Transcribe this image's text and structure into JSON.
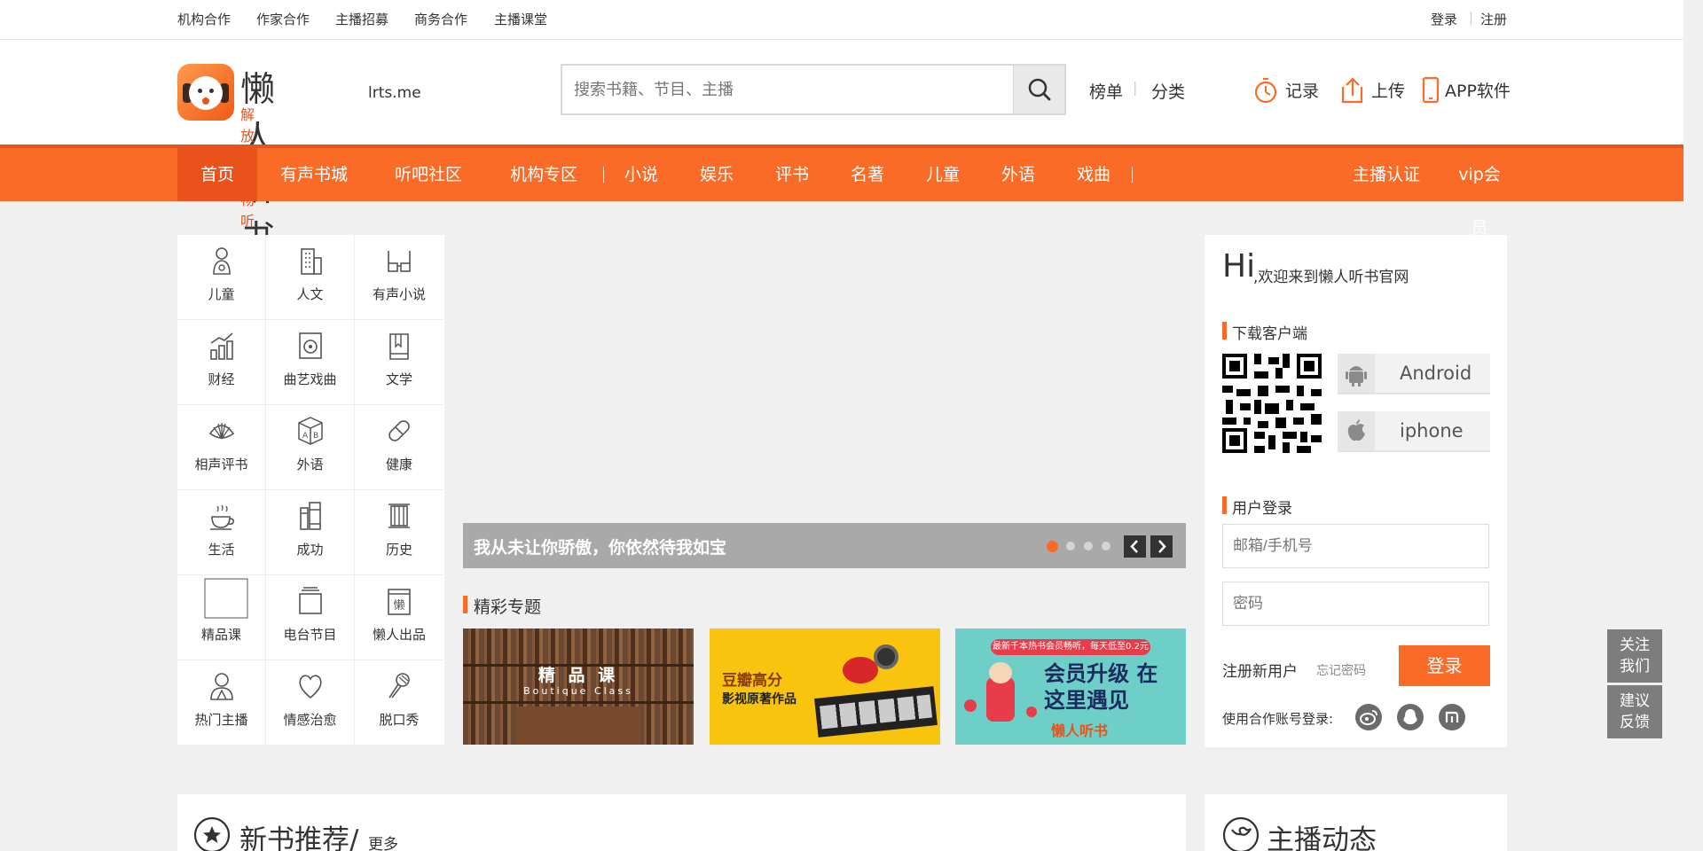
{
  "topbar": {
    "links": [
      "机构合作",
      "作家合作",
      "主播招募",
      "商务合作",
      "主播课堂"
    ],
    "login": "登录",
    "register": "注册"
  },
  "header": {
    "logo_title": "懒人听书",
    "logo_domain": "lrts.me",
    "logo_slogan": "解放双眼畅听世界",
    "search_placeholder": "搜索书籍、节目、主播",
    "links": {
      "rank": "榜单",
      "category": "分类"
    },
    "actions": {
      "record": "记录",
      "upload": "上传",
      "app": "APP软件"
    }
  },
  "nav": {
    "main": [
      "首页",
      "有声书城",
      "听吧社区",
      "机构专区"
    ],
    "genres": [
      "小说",
      "娱乐",
      "评书",
      "名著",
      "儿童",
      "外语",
      "戏曲"
    ],
    "right": [
      "主播认证",
      "vip会员"
    ]
  },
  "categories": [
    {
      "label": "儿童",
      "icon": "baby-icon"
    },
    {
      "label": "人文",
      "icon": "building-icon"
    },
    {
      "label": "有声小说",
      "icon": "glasses-icon"
    },
    {
      "label": "财经",
      "icon": "bar-chart-icon"
    },
    {
      "label": "曲艺戏曲",
      "icon": "speaker-icon"
    },
    {
      "label": "文学",
      "icon": "book-icon"
    },
    {
      "label": "相声评书",
      "icon": "fan-icon"
    },
    {
      "label": "外语",
      "icon": "ab-cube-icon"
    },
    {
      "label": "健康",
      "icon": "pill-icon"
    },
    {
      "label": "生活",
      "icon": "coffee-icon"
    },
    {
      "label": "成功",
      "icon": "books-icon"
    },
    {
      "label": "历史",
      "icon": "scroll-icon"
    },
    {
      "label": "精品课",
      "icon": "blank-icon"
    },
    {
      "label": "电台节目",
      "icon": "radio-icon"
    },
    {
      "label": "懒人出品",
      "icon": "lazy-logo-icon"
    },
    {
      "label": "热门主播",
      "icon": "person-icon"
    },
    {
      "label": "情感治愈",
      "icon": "heart-icon"
    },
    {
      "label": "脱口秀",
      "icon": "microphone-icon"
    }
  ],
  "banner": {
    "caption": "我从未让你骄傲，你依然待我如宝",
    "dots": 4,
    "active_dot": 0
  },
  "featured": {
    "title": "精彩专题",
    "items": [
      {
        "title": "精 品 课",
        "subtitle": "Boutique Class",
        "color": "#6e4a34"
      },
      {
        "title": "豆瓣高分",
        "subtitle": "影视原著作品",
        "color": "#f9c40d"
      },
      {
        "title": "会员升级 在这里遇见",
        "subtitle": "最新千本热书会员畅听，每天低至0.2元",
        "brand": "懒人听书",
        "color": "#6ecfc9"
      }
    ]
  },
  "sidebar": {
    "greeting_hi": "Hi",
    "greeting_text": ",欢迎来到懒人听书官网",
    "download_title": "下载客户端",
    "android": "Android",
    "iphone": "iphone",
    "login_title": "用户登录",
    "account_placeholder": "邮箱/手机号",
    "password_placeholder": "密码",
    "register_link": "注册新用户",
    "forgot_link": "忘记密码",
    "login_button": "登录",
    "partner_label": "使用合作账号登录:"
  },
  "float": {
    "follow": [
      "关注",
      "我们"
    ],
    "feedback": [
      "建议",
      "反馈"
    ]
  },
  "sections": {
    "new_books": "新书推荐/",
    "more": "更多",
    "anchor_news": "主播动态"
  },
  "colors": {
    "brand_orange": "#f96b26",
    "nav_active": "#e9521a",
    "float_gray": "#7d7d7d"
  }
}
